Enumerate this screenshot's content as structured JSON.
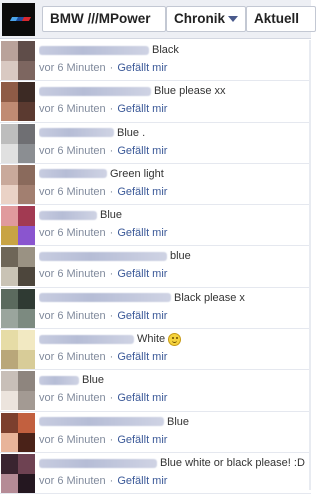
{
  "header": {
    "page_name": "BMW ///MPower",
    "timeline_label": "Chronik",
    "current_label": "Aktuell"
  },
  "comments": [
    {
      "text": "Black",
      "blur": 110,
      "time": "vor 6 Minuten",
      "like": "Gefällt mir",
      "avatar": [
        "#b9a29a",
        "#5f4d49",
        "#d9c9c2",
        "#7d6660"
      ]
    },
    {
      "text": "Blue please xx",
      "blur": 112,
      "time": "vor 6 Minuten",
      "like": "Gefällt mir",
      "avatar": [
        "#8e5b46",
        "#3c2a24",
        "#c08b73",
        "#5b3a30"
      ]
    },
    {
      "text": "Blue .",
      "blur": 75,
      "time": "vor 6 Minuten",
      "like": "Gefällt mir",
      "avatar": [
        "#bdbdbd",
        "#6f6f73",
        "#e0e0e0",
        "#8b8e92"
      ]
    },
    {
      "text": "Green light",
      "blur": 68,
      "time": "vor 6 Minuten",
      "like": "Gefällt mir",
      "avatar": [
        "#c9a99b",
        "#8a6a5c",
        "#ead2c6",
        "#a27f70"
      ]
    },
    {
      "text": "Blue",
      "blur": 58,
      "time": "vor 6 Minuten",
      "like": "Gefällt mir",
      "avatar": [
        "#e09a9d",
        "#a23a52",
        "#c8a344",
        "#8a55cf"
      ]
    },
    {
      "text": "blue",
      "blur": 128,
      "time": "vor 6 Minuten",
      "like": "Gefällt mir",
      "avatar": [
        "#6e6658",
        "#9a9283",
        "#c9c3b5",
        "#4d463c"
      ]
    },
    {
      "text": "Black please x",
      "blur": 132,
      "time": "vor 6 Minuten",
      "like": "Gefällt mir",
      "avatar": [
        "#5b6a5e",
        "#2f3a33",
        "#9aa59d",
        "#7c8a80"
      ]
    },
    {
      "text": "White",
      "blur": 95,
      "time": "vor 6 Minuten",
      "like": "Gefällt mir",
      "avatar": [
        "#e6dca6",
        "#f2e9c2",
        "#b9a77a",
        "#d8cc98"
      ]
    },
    {
      "text": "Blue",
      "blur": 40,
      "time": "vor 6 Minuten",
      "like": "Gefällt mir",
      "avatar": [
        "#c8bfb8",
        "#8e857e",
        "#ece4dd",
        "#a39a93"
      ]
    },
    {
      "text": "Blue",
      "blur": 125,
      "time": "vor 6 Minuten",
      "like": "Gefällt mir",
      "avatar": [
        "#7c3f2e",
        "#c2603f",
        "#e8b49a",
        "#4a2218"
      ]
    },
    {
      "text": "Blue white or black please! :D",
      "blur": 118,
      "time": "vor 6 Minuten",
      "like": "Gefällt mir",
      "avatar": [
        "#3a2430",
        "#6e4252",
        "#b58b96",
        "#241720"
      ]
    }
  ],
  "smiley_comment_index": 7,
  "colors": {
    "link": "#3b5998",
    "meta": "#808a9c",
    "header_bg": "#edeff4"
  }
}
